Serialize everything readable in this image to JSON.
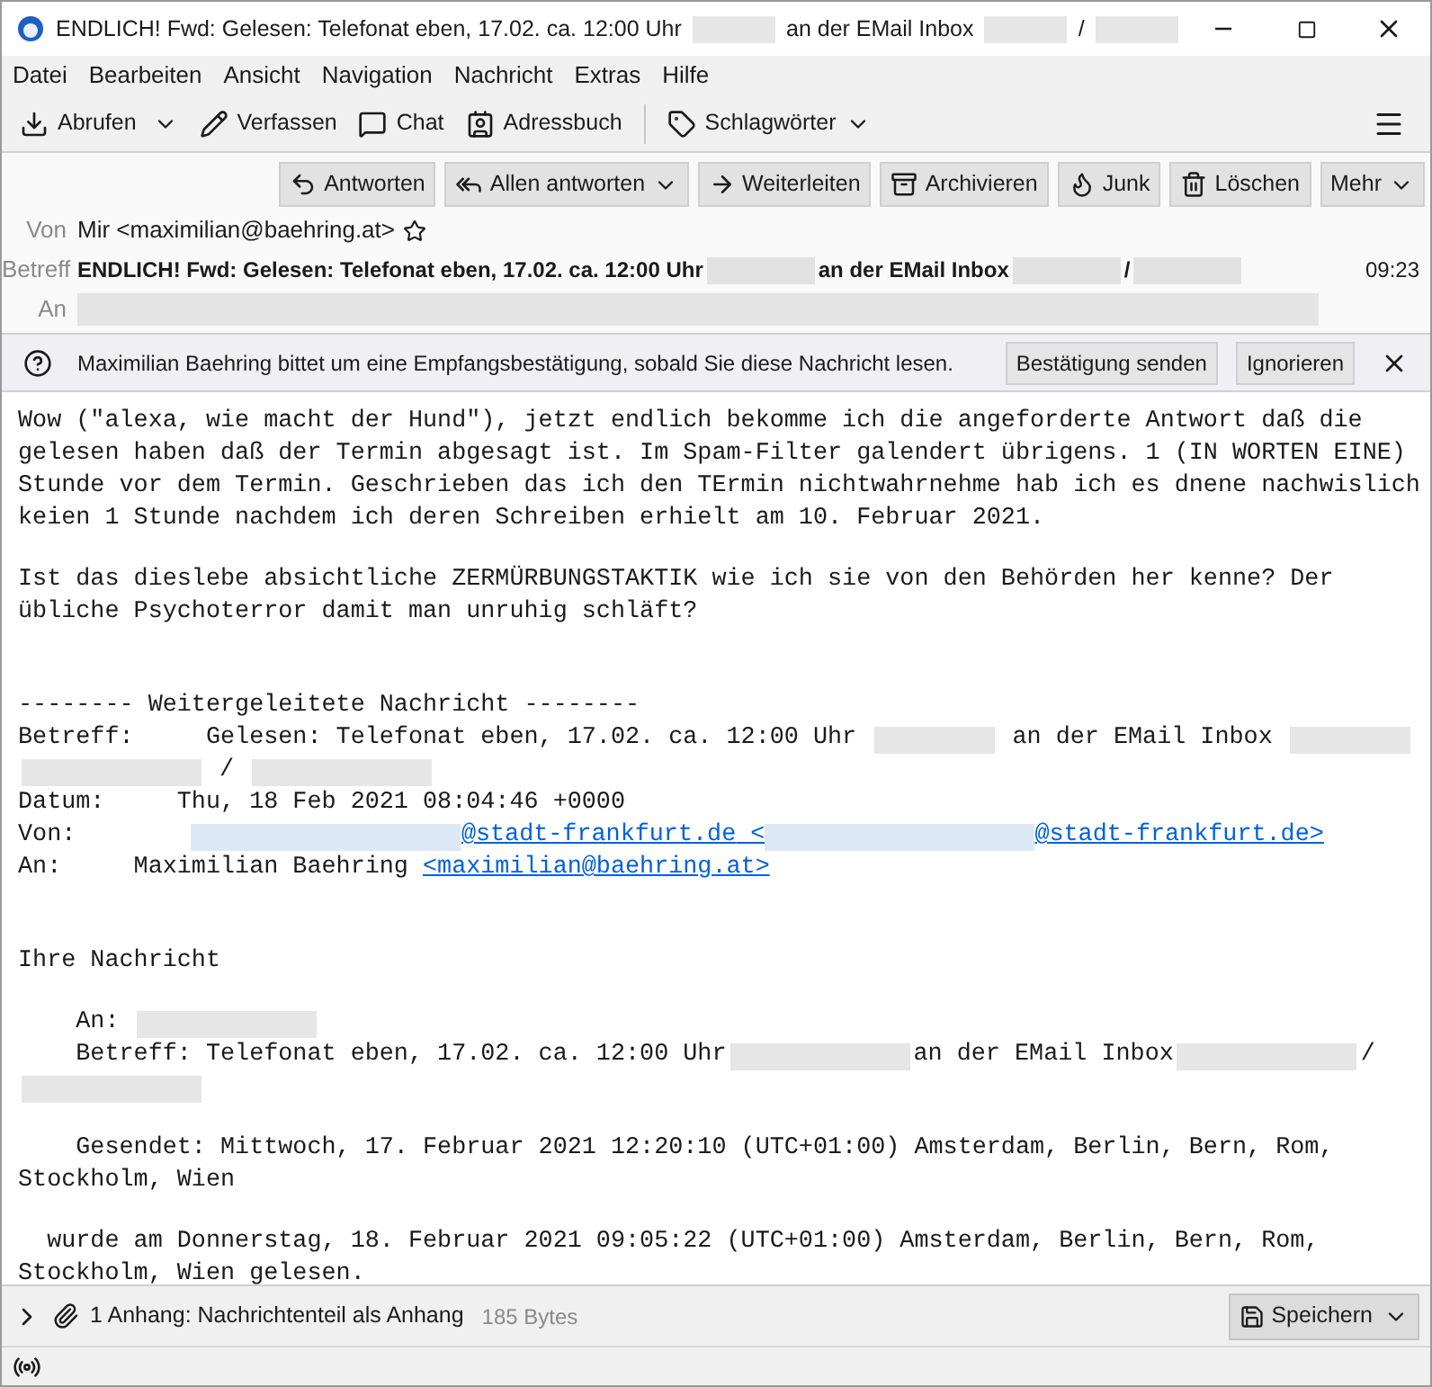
{
  "window": {
    "title": [
      {
        "kind": "text",
        "text": "ENDLICH! Fwd: Gelesen: Telefonat eben, 17.02. ca. 12:00 Uhr"
      },
      {
        "kind": "redacted"
      },
      {
        "kind": "text",
        "text": "an der EMail Inbox"
      },
      {
        "kind": "redacted"
      },
      {
        "kind": "text",
        "text": "/"
      },
      {
        "kind": "redacted"
      }
    ]
  },
  "menu": [
    {
      "label": "Datei"
    },
    {
      "label": "Bearbeiten"
    },
    {
      "label": "Ansicht"
    },
    {
      "label": "Navigation"
    },
    {
      "label": "Nachricht"
    },
    {
      "label": "Extras"
    },
    {
      "label": "Hilfe"
    }
  ],
  "toolbar": [
    {
      "label": "Abrufen",
      "dropdown": true
    },
    {
      "label": "Verfassen",
      "dropdown": false
    },
    {
      "label": "Chat",
      "dropdown": false
    },
    {
      "label": "Adressbuch",
      "dropdown": false
    },
    {
      "label": "Schlagwörter",
      "dropdown": true
    }
  ],
  "actions": [
    {
      "label": "Antworten",
      "dropdown": false
    },
    {
      "label": "Allen antworten",
      "dropdown": true
    },
    {
      "label": "Weiterleiten",
      "dropdown": false
    },
    {
      "label": "Archivieren",
      "dropdown": false
    },
    {
      "label": "Junk",
      "dropdown": false
    },
    {
      "label": "Löschen",
      "dropdown": false
    },
    {
      "label": "Mehr",
      "dropdown": true
    }
  ],
  "header": {
    "from_label": "Von",
    "from": "Mir <maximilian@baehring.at>",
    "subject_label": "Betreff",
    "subject": [
      {
        "kind": "text",
        "text": "ENDLICH! Fwd: Gelesen: Telefonat eben, 17.02. ca. 12:00 Uhr"
      },
      {
        "kind": "redacted"
      },
      {
        "kind": "text",
        "text": "an der EMail Inbox"
      },
      {
        "kind": "redacted"
      },
      {
        "kind": "text",
        "text": "/"
      },
      {
        "kind": "redacted"
      }
    ],
    "time": "09:23",
    "to_label": "An"
  },
  "notification": {
    "text": "Maximilian Baehring bittet um eine Empfangsbestätigung, sobald Sie diese Nachricht lesen.",
    "buttons": [
      "Bestätigung senden",
      "Ignorieren"
    ]
  },
  "body": [
    {
      "kind": "paragraph",
      "lines": [
        [
          {
            "kind": "text",
            "text": "Wow (\"alexa, wie macht der Hund\"), jetzt endlich bekomme ich die angeforderte Antwort daß die"
          }
        ],
        [
          {
            "kind": "text",
            "text": "gelesen haben daß der Termin abgesagt ist. Im Spam-Filter galendert übrigens. 1 (IN WORTEN EINE)"
          }
        ],
        [
          {
            "kind": "text",
            "text": "Stunde vor dem Termin. Geschrieben das ich den TErmin nichtwahrnehme hab ich es dnene nachwislich"
          }
        ],
        [
          {
            "kind": "text",
            "text": "keien 1 Stunde nachdem ich deren Schreiben erhielt am 10. Februar 2021."
          }
        ]
      ]
    },
    {
      "kind": "paragraph",
      "lines": [
        [
          {
            "kind": "text",
            "text": "Ist das dieslebe absichtliche ZERMÜRBUNGSTAKTIK wie ich sie von den Behörden her kenne? Der"
          }
        ],
        [
          {
            "kind": "text",
            "text": "übliche Psychoterror damit man unruhig schläft?"
          }
        ]
      ]
    },
    {
      "kind": "section",
      "lines": [
        [
          {
            "kind": "text",
            "text": "-------- Weitergeleitete Nachricht --------"
          }
        ],
        [
          {
            "kind": "text",
            "text": "Betreff:     Gelesen: Telefonat eben, 17.02. ca. 12:00 Uhr "
          },
          {
            "kind": "redacted"
          },
          {
            "kind": "text",
            "text": " an der EMail Inbox "
          },
          {
            "kind": "redacted"
          }
        ],
        [
          {
            "kind": "redacted"
          },
          {
            "kind": "text",
            "text": " / "
          },
          {
            "kind": "redacted"
          }
        ],
        [
          {
            "kind": "text",
            "text": "Datum:     Thu, 18 Feb 2021 08:04:46 +0000"
          }
        ],
        [
          {
            "kind": "text",
            "text": "Von:        "
          },
          {
            "kind": "redacted_link"
          },
          {
            "kind": "link",
            "text": "@stadt-frankfurt.de"
          },
          {
            "kind": "link",
            "text": " <"
          },
          {
            "kind": "redacted_link"
          },
          {
            "kind": "link",
            "text": "@stadt-frankfurt.de>"
          }
        ],
        [
          {
            "kind": "text",
            "text": "An:     Maximilian Baehring "
          },
          {
            "kind": "link",
            "text": "<maximilian@baehring.at>"
          }
        ]
      ]
    },
    {
      "kind": "section",
      "lines": [
        [
          {
            "kind": "text",
            "text": "Ihre Nachricht"
          }
        ]
      ]
    },
    {
      "kind": "paragraph",
      "lines": [
        [
          {
            "kind": "text",
            "text": "    An: "
          },
          {
            "kind": "redacted"
          }
        ],
        [
          {
            "kind": "text",
            "text": "    Betreff: Telefonat eben, 17.02. ca. 12:00 Uhr"
          },
          {
            "kind": "redacted"
          },
          {
            "kind": "text",
            "text": "an der EMail Inbox"
          },
          {
            "kind": "redacted"
          },
          {
            "kind": "text",
            "text": "/"
          }
        ],
        [
          {
            "kind": "redacted"
          }
        ]
      ]
    },
    {
      "kind": "paragraph",
      "lines": [
        [
          {
            "kind": "text",
            "text": "    Gesendet: Mittwoch, 17. Februar 2021 12:20:10 (UTC+01:00) Amsterdam, Berlin, Bern, Rom,"
          }
        ],
        [
          {
            "kind": "text",
            "text": "Stockholm, Wien"
          }
        ]
      ]
    },
    {
      "kind": "paragraph",
      "lines": [
        [
          {
            "kind": "text",
            "text": "  wurde am Donnerstag, 18. Februar 2021 09:05:22 (UTC+01:00) Amsterdam, Berlin, Bern, Rom,"
          }
        ],
        [
          {
            "kind": "text",
            "text": "Stockholm, Wien gelesen."
          }
        ]
      ]
    }
  ],
  "attachment": {
    "label": "1 Anhang: Nachrichtenteil als Anhang",
    "size": "185 Bytes",
    "save": "Speichern"
  }
}
